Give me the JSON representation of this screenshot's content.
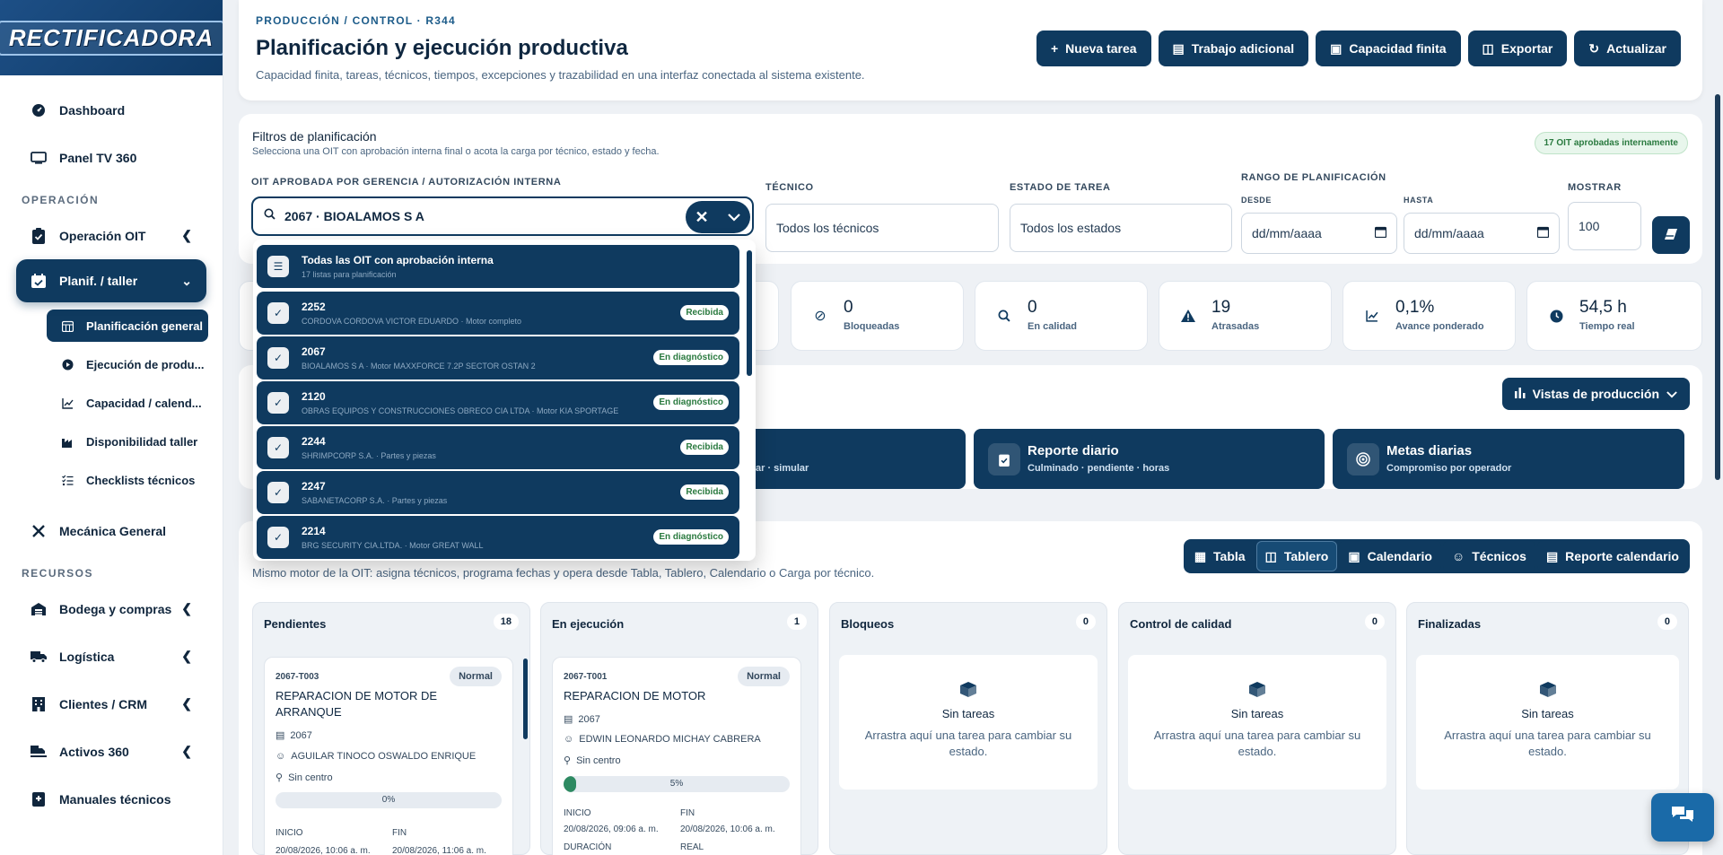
{
  "brand": {
    "logo_text": "RECTIFICADORA"
  },
  "sidebar": {
    "items_top": [
      {
        "label": "Dashboard",
        "icon": "gauge-icon"
      },
      {
        "label": "Panel TV 360",
        "icon": "monitor-icon"
      }
    ],
    "section_operacion": "OPERACIÓN",
    "operacion_oit": "Operación OIT",
    "planif_taller": "Planif. / taller",
    "sub": [
      "Planificación general",
      "Ejecución de produ...",
      "Capacidad / calend...",
      "Disponibilidad taller",
      "Checklists técnicos"
    ],
    "mecanica": "Mecánica General",
    "section_recursos": "RECURSOS",
    "recursos": [
      "Bodega y compras",
      "Logística",
      "Clientes / CRM",
      "Activos 360",
      "Manuales técnicos"
    ]
  },
  "header": {
    "breadcrumb": "PRODUCCIÓN / CONTROL · R344",
    "title": "Planificación y ejecución productiva",
    "subtitle": "Capacidad finita, tareas, técnicos, tiempos, excepciones y trazabilidad en una interfaz conectada al sistema existente.",
    "actions": [
      "Nueva tarea",
      "Trabajo adicional",
      "Capacidad finita",
      "Exportar",
      "Actualizar"
    ]
  },
  "filters": {
    "title": "Filtros de planificación",
    "subtitle": "Selecciona una OIT con aprobación interna final o acota la carga por técnico, estado y fecha.",
    "badge": "17 OIT aprobadas internamente",
    "oit_label": "OIT APROBADA POR GERENCIA / AUTORIZACIÓN INTERNA",
    "oit_value": "2067 · BIOALAMOS S A",
    "tecnico_label": "TÉCNICO",
    "tecnico_value": "Todos los técnicos",
    "estado_label": "ESTADO DE TAREA",
    "estado_value": "Todos los estados",
    "rango_label": "RANGO DE PLANIFICACIÓN",
    "desde_label": "DESDE",
    "hasta_label": "HASTA",
    "date_placeholder": "dd/mm/aaaa",
    "mostrar_label": "MOSTRAR",
    "mostrar_value": "100"
  },
  "dropdown": {
    "all": {
      "title": "Todas las OIT con aprobación interna",
      "sub": "17 listas para planificación"
    },
    "items": [
      {
        "id": "2252",
        "sub": "CORDOVA CORDOVA VICTOR EDUARDO · Motor completo",
        "badge": "Recibida"
      },
      {
        "id": "2067",
        "sub": "BIOALAMOS S A · Motor MAXXFORCE 7.2P SECTOR OSTAN 2",
        "badge": "En diagnóstico"
      },
      {
        "id": "2120",
        "sub": "OBRAS EQUIPOS Y CONSTRUCCIONES OBRECO CIA LTDA · Motor KIA SPORTAGE",
        "badge": "En diagnóstico"
      },
      {
        "id": "2244",
        "sub": "SHRIMPCORP S.A. · Partes y piezas",
        "badge": "Recibida"
      },
      {
        "id": "2247",
        "sub": "SABANETACORP S.A. · Partes y piezas",
        "badge": "Recibida"
      },
      {
        "id": "2214",
        "sub": "BRG SECURITY CIA.LTDA. · Motor GREAT WALL",
        "badge": "En diagnóstico"
      }
    ]
  },
  "kpis": [
    {
      "value": "0",
      "label": "Bloqueadas",
      "icon": "ban-icon"
    },
    {
      "value": "0",
      "label": "En calidad",
      "icon": "search-icon"
    },
    {
      "value": "19",
      "label": "Atrasadas",
      "icon": "warning-icon"
    },
    {
      "value": "0,1%",
      "label": "Avance ponderado",
      "icon": "trend-icon"
    },
    {
      "value": "54,5 h",
      "label": "Tiempo real",
      "icon": "clock-icon"
    }
  ],
  "views": {
    "button": "Vistas de producción",
    "card0_sub": "ar · simular",
    "reporte_title": "Reporte diario",
    "reporte_sub": "Culminado · pendiente · horas",
    "metas_title": "Metas diarias",
    "metas_sub": "Compromiso por operador"
  },
  "board": {
    "subtitle": "Mismo motor de la OIT: asigna técnicos, programa fechas y opera desde Tabla, Tablero, Calendario o Carga por técnico.",
    "tabs": [
      "Tabla",
      "Tablero",
      "Calendario",
      "Técnicos",
      "Reporte calendario"
    ],
    "columns": [
      {
        "title": "Pendientes",
        "count": "18"
      },
      {
        "title": "En ejecución",
        "count": "1"
      },
      {
        "title": "Bloqueos",
        "count": "0"
      },
      {
        "title": "Control de calidad",
        "count": "0"
      },
      {
        "title": "Finalizadas",
        "count": "0"
      }
    ],
    "empty_title": "Sin tareas",
    "empty_desc": "Arrastra aquí una tarea para cambiar su estado.",
    "task1": {
      "id": "2067-T003",
      "prio": "Normal",
      "title": "REPARACION DE MOTOR DE ARRANQUE",
      "oit": "2067",
      "tech": "AGUILAR TINOCO OSWALDO ENRIQUE",
      "center": "Sin centro",
      "progress_label": "0%",
      "progress": 0,
      "inicio_label": "INICIO",
      "fin_label": "FIN",
      "inicio": "20/08/2026, 10:06 a. m.",
      "fin": "20/08/2026, 11:06 a. m."
    },
    "task2": {
      "id": "2067-T001",
      "prio": "Normal",
      "title": "REPARACION DE MOTOR",
      "oit": "2067",
      "tech": "EDWIN LEONARDO MICHAY CABRERA",
      "center": "Sin centro",
      "progress_label": "5%",
      "progress": 5,
      "inicio_label": "INICIO",
      "fin_label": "FIN",
      "inicio": "20/08/2026, 09:06 a. m.",
      "fin": "20/08/2026, 10:06 a. m.",
      "duracion_label": "DURACIÓN",
      "real_label": "REAL"
    }
  },
  "colors": {
    "primary": "#0f3a5f",
    "accent": "#1a6aa8",
    "success": "#2e8a62"
  }
}
